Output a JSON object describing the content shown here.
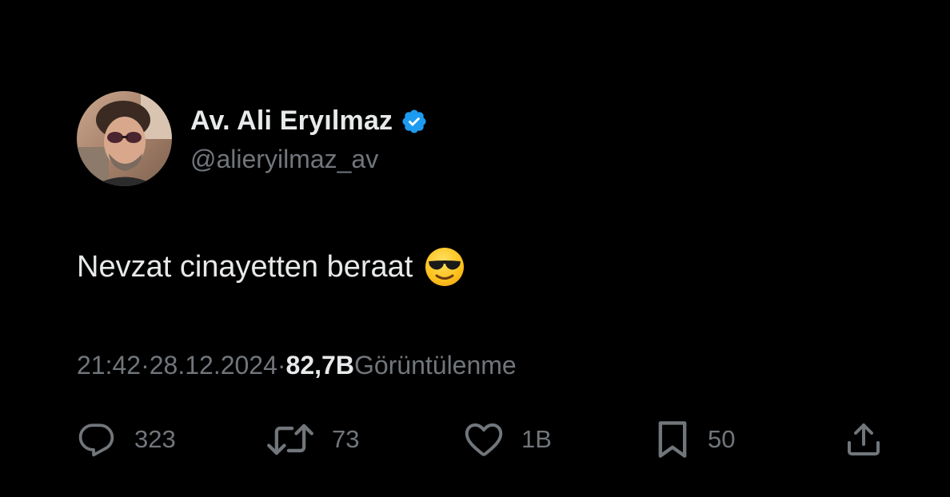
{
  "author": {
    "display_name": "Av. Ali Eryılmaz",
    "handle": "@alieryilmaz_av",
    "verified": true,
    "verified_color": "#1d9bf0"
  },
  "tweet": {
    "text": "Nevzat cinayetten beraat",
    "emoji": "smiling-face-with-sunglasses",
    "time": "21:42",
    "separator": "·",
    "date": "28.12.2024",
    "views_count": "82,7B",
    "views_label": "Görüntülenme"
  },
  "actions": {
    "replies": "323",
    "retweets": "73",
    "likes": "1B",
    "bookmarks": "50"
  },
  "icons": {
    "reply": "reply-icon",
    "retweet": "retweet-icon",
    "like": "heart-icon",
    "bookmark": "bookmark-icon",
    "share": "share-icon"
  },
  "colors": {
    "background": "#000000",
    "primary_text": "#e7e9ea",
    "secondary_text": "#71767b"
  }
}
